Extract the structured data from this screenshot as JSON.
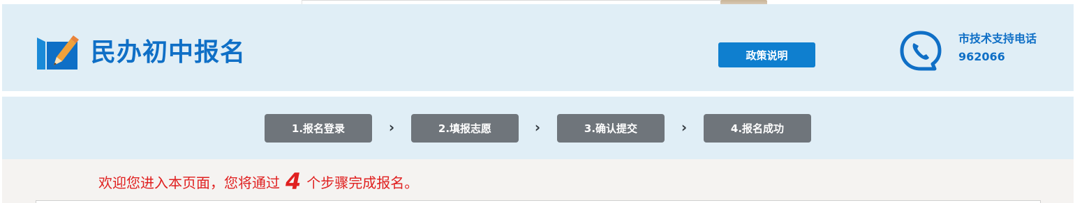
{
  "header": {
    "title": "民办初中报名",
    "policy_button": "政策说明",
    "support_label": "市技术支持电话",
    "support_number": "962066"
  },
  "steps": [
    {
      "label": "1.报名登录"
    },
    {
      "label": "2.填报志愿"
    },
    {
      "label": "3.确认提交"
    },
    {
      "label": "4.报名成功"
    }
  ],
  "step_separator": "›",
  "welcome": {
    "before": "欢迎您进入本页面，您将通过",
    "count": "4",
    "after": "个步骤完成报名。"
  },
  "colors": {
    "header_bg": "#e0eef6",
    "brand_blue": "#0f6fc6",
    "button_blue": "#0f7fcf",
    "step_gray": "#6f757b",
    "welcome_red": "#e02020",
    "content_bg": "#f5f3f1"
  },
  "icons": {
    "logo": "edit-pencil-icon",
    "support": "phone-chat-icon",
    "separator": "chevron-right-icon"
  }
}
